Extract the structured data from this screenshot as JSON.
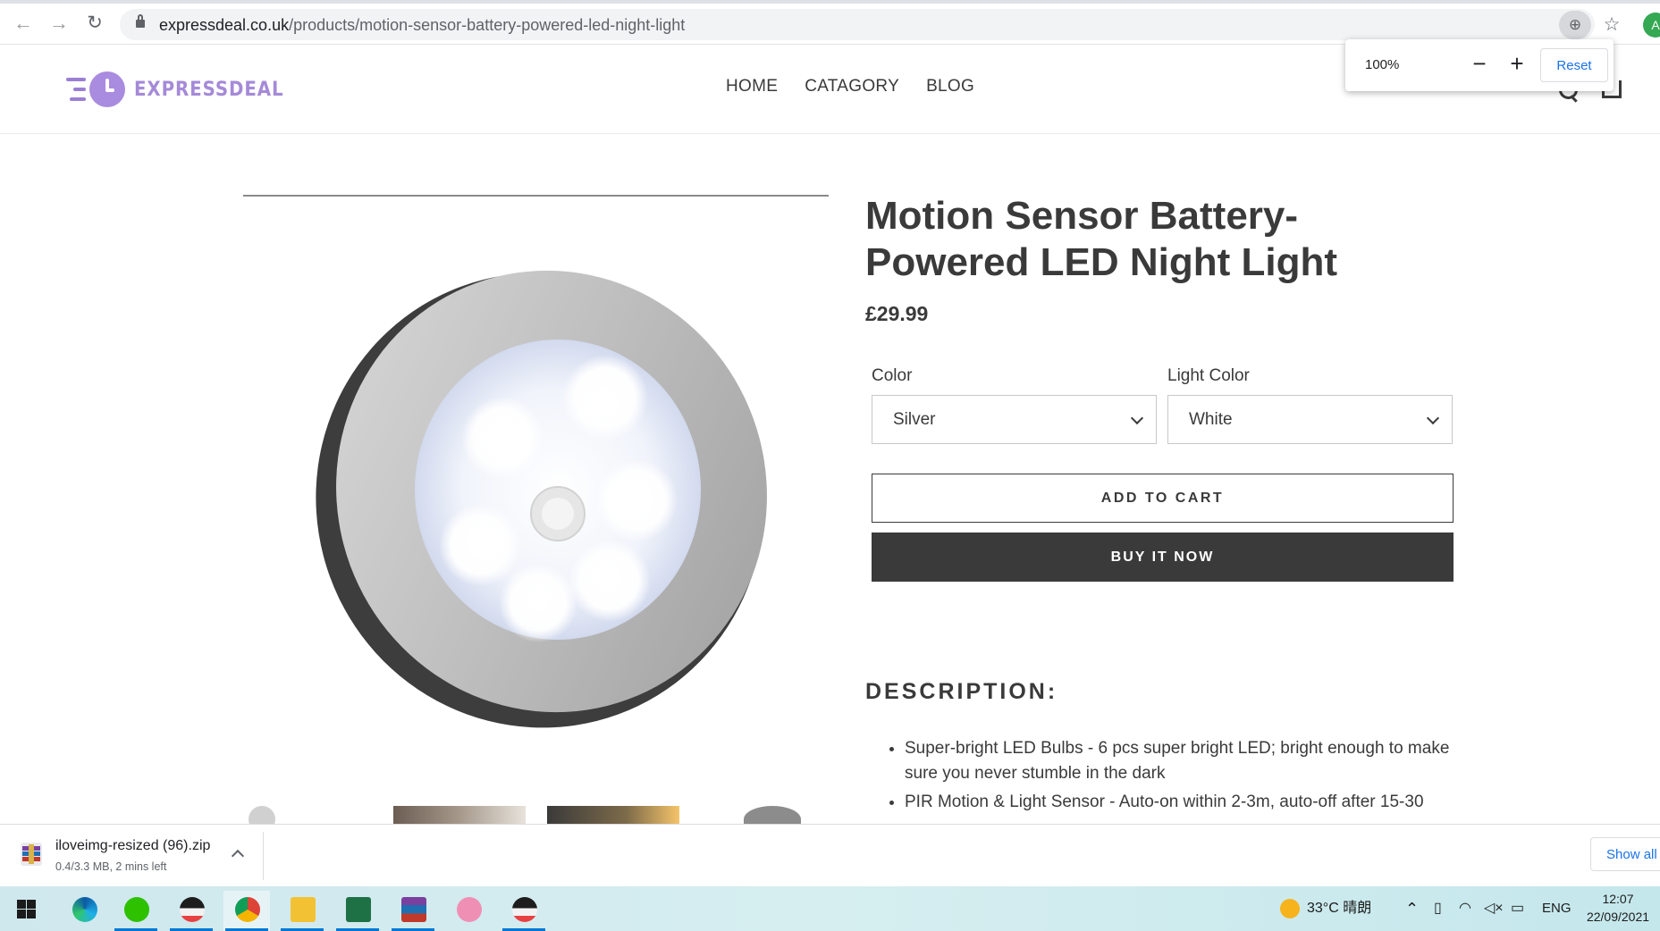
{
  "browser": {
    "url_domain": "expressdeal.co.uk",
    "url_path": "/products/motion-sensor-battery-powered-led-night-light",
    "avatar_letter": "A",
    "zoom_popup": {
      "level": "100%",
      "minus": "−",
      "plus": "+",
      "reset_label": "Reset"
    }
  },
  "site": {
    "logo_text": "EXPRESSDEAL",
    "brand_color": "#a58ad8",
    "nav": [
      {
        "label": "HOME"
      },
      {
        "label": "CATAGORY"
      },
      {
        "label": "BLOG"
      }
    ]
  },
  "product": {
    "title": "Motion Sensor Battery-Powered LED Night Light",
    "price": "£29.99",
    "options": [
      {
        "label": "Color",
        "value": "Silver"
      },
      {
        "label": "Light Color",
        "value": "White"
      }
    ],
    "add_to_cart": "ADD TO CART",
    "buy_now": "BUY IT NOW",
    "description_heading": "DESCRIPTION:",
    "description_items": [
      "Super-bright LED Bulbs - 6 pcs super bright LED; bright enough to make sure you never stumble in the dark",
      "PIR Motion & Light Sensor - Auto-on within 2-3m, auto-off after 15-30"
    ]
  },
  "download": {
    "filename": "iloveimg-resized (96).zip",
    "status": "0.4/3.3 MB, 2 mins left",
    "show_all": "Show all"
  },
  "taskbar": {
    "weather": "33°C 晴朗",
    "language": "ENG",
    "time": "12:07",
    "date": "22/09/2021"
  }
}
